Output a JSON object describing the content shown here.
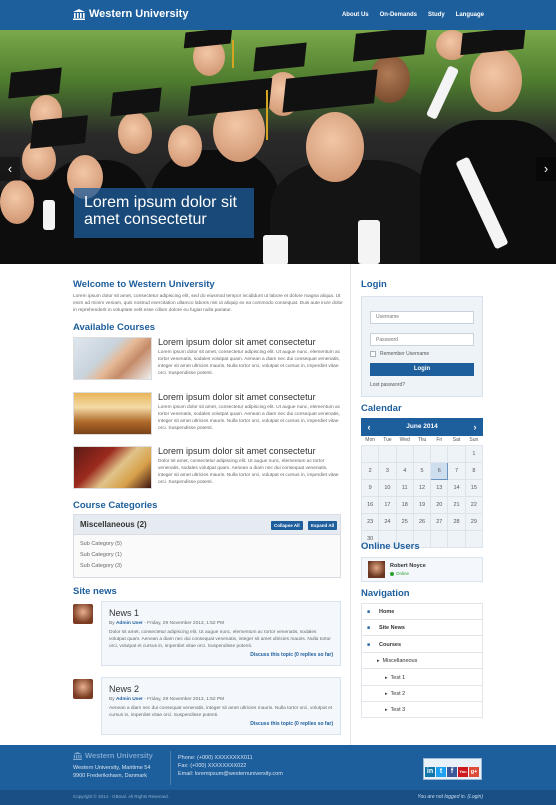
{
  "header": {
    "site_title": "Western University",
    "nav": [
      "About Us",
      "On-Demands",
      "Study",
      "Language"
    ]
  },
  "hero": {
    "caption": "Lorem ipsum dolor sit amet consectetur",
    "prev_arrow": "‹",
    "next_arrow": "›"
  },
  "welcome": {
    "title": "Welcome to Western University",
    "text": "Lorem ipsum dolor sit amet, consectetur adipiscing elit, sed do eiusmod tempor incididunt ut labore et dolore magna aliqua. Ut enim ad minim veniam, quis nostrud exercitation ullamco laboris nisi ut aliquip ex ea commodo consequat. Duis aute irure dolor in reprehenderit in voluptate velit esse cillum dolore eu fugiat nulla pariatur."
  },
  "courses": {
    "title": "Available Courses",
    "items": [
      {
        "title": "Lorem ipsum dolor sit amet consectetur",
        "text": "Lorem ipsum dolor sit amet, consectetur adipiscing elit. Ut augue nunc, elementum ac tortor venenatis, sodales volutpat quam. Aenean a diam nec dui consequat venenatis, integer sit amet ultricies mauris. Nulla tortor orci, volutpat et cursus in, imperdiet vitae orci. Suspendisse potenti."
      },
      {
        "title": "Lorem ipsum dolor sit amet consectetur",
        "text": "Lorem ipsum dolor sit amet, consectetur adipiscing elit. Ut augue nunc, elementum ac tortor venenatis, sodales volutpat quam. Aenean a diam nec dui consequat venenatis, integer sit amet ultricies mauris. Nulla tortor orci, volutpat et cursus in, imperdiet vitae orci. Suspendisse potenti."
      },
      {
        "title": "Lorem ipsum dolor sit amet consectetur",
        "text": "Dolor sit amet, consectetur adipiscing elit. Ut augue nunc, elementum ac tortor venenatis, sodales volutpat quam. Aenean a diam nec dui consequat venenatis, integer sit amet ultricies mauris. Nulla tortor orci, volutpat et cursus in, imperdiet vitae orci. Suspendisse potenti."
      }
    ]
  },
  "categories": {
    "title": "Course Categories",
    "group": "Miscellaneous (2)",
    "collapse_label": "Collapse All",
    "expand_label": "Expand All",
    "items": [
      "Sub Category (5)",
      "Sub Category (1)",
      "Sub Category (3)"
    ]
  },
  "site_news": {
    "title": "Site news",
    "items": [
      {
        "title": "News 1",
        "by": "By",
        "author": "Admin User",
        "date": "- Friday, 29 November 2013, 1:52 PM",
        "text": "Dolor sit amet, consectetur adipiscing elit. Ut augue nunc, elementum ac tortor venenatis, sodales volutpat quam. Aenean a diam nec dui consequat venenatis, integer sit amet ultricies mauris. Nulla tortor orci, volutpat et cursus in, imperdiet vitae orci. Suspendisse potenti.",
        "discuss": "Discuss this topic (0 replies so far)"
      },
      {
        "title": "News 2",
        "by": "By",
        "author": "Admin User",
        "date": "- Friday, 29 November 2013, 1:52 PM",
        "text": "Aenean a diam nec dui consequat venenatis, integer sit amet ultricies mauris. Nulla tortor orci, volutpat et cursus in, imperdiet vitae orci. Suspendisse potenti.",
        "discuss": "Discuss this topic (0 replies so far)"
      }
    ]
  },
  "login": {
    "title": "Login",
    "username_placeholder": "Username",
    "password_placeholder": "Password",
    "remember_label": "Remember Username",
    "button_label": "Login",
    "forgot_label": "Lost password?"
  },
  "calendar": {
    "title": "Calendar",
    "month": "June 2014",
    "days": [
      "Mon",
      "Tue",
      "Wed",
      "Thu",
      "Fri",
      "Sat",
      "Sun"
    ],
    "weeks": [
      [
        "",
        "",
        "",
        "",
        "",
        "",
        "1"
      ],
      [
        "2",
        "3",
        "4",
        "5",
        "6",
        "7",
        "8"
      ],
      [
        "9",
        "10",
        "11",
        "12",
        "13",
        "14",
        "15"
      ],
      [
        "16",
        "17",
        "18",
        "19",
        "20",
        "21",
        "22"
      ],
      [
        "23",
        "24",
        "25",
        "26",
        "27",
        "28",
        "29"
      ],
      [
        "30",
        "",
        "",
        "",
        "",
        "",
        ""
      ]
    ],
    "today": "6"
  },
  "online_users": {
    "title": "Online Users",
    "name": "Robert Noyce",
    "status": "Online"
  },
  "navigation": {
    "title": "Navigation",
    "items": [
      {
        "label": "Home",
        "level": 0
      },
      {
        "label": "Site News",
        "level": 0
      },
      {
        "label": "Courses",
        "level": 0
      },
      {
        "label": "Miscellaneous",
        "level": 1
      },
      {
        "label": "Test 1",
        "level": 2
      },
      {
        "label": "Test 2",
        "level": 2
      },
      {
        "label": "Test 3",
        "level": 2
      }
    ]
  },
  "footer": {
    "logo_text": "Western University",
    "address_1": "Western University, Maritime 54",
    "address_2": "9900 Frederikshavn, Danmark",
    "phone": "Phone: (+000) XXXXXXXX011",
    "fax": "Fax: (+000) XXXXXXXX022",
    "email": "Email: loremipsum@westernuniversity.com",
    "social": [
      "in",
      "t",
      "f",
      "You",
      "g+"
    ],
    "copyright": "Copyright © 2014 - GBmal. All Rights Reserved.",
    "login_status": "You are not logged in. (Login)"
  }
}
